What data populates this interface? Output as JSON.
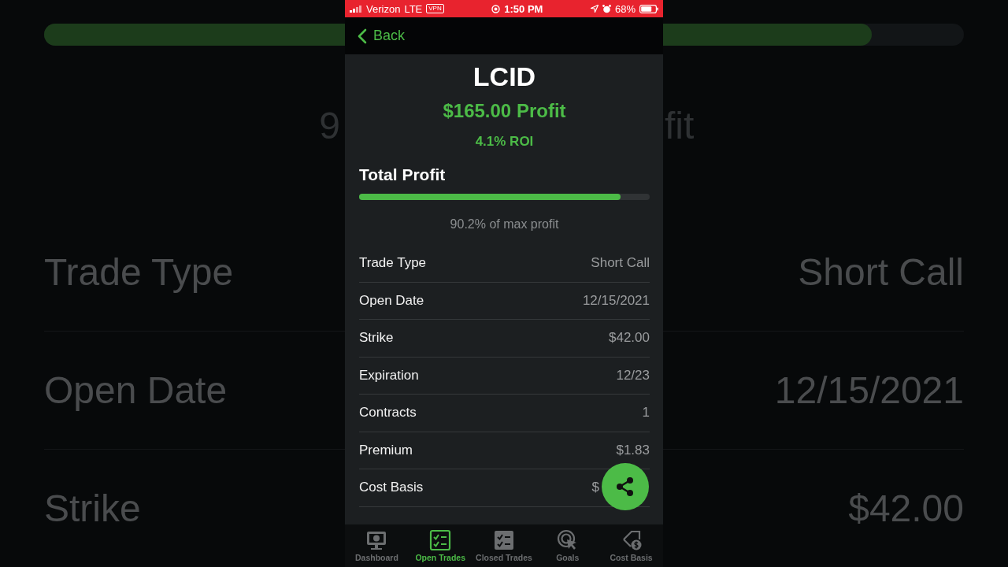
{
  "backdrop": {
    "progress": {
      "level": 0.9
    },
    "fragments": [
      "9",
      "fit"
    ],
    "rows": [
      {
        "label": "Trade Type",
        "value": "Short Call"
      },
      {
        "label": "Open Date",
        "value": "12/15/2021"
      },
      {
        "label": "Strike",
        "value": "$42.00"
      }
    ]
  },
  "status_bar": {
    "carrier": "Verizon",
    "network": "LTE",
    "vpn": "VPN",
    "time": "1:50 PM",
    "battery": "68%"
  },
  "nav": {
    "back": "Back"
  },
  "trade": {
    "symbol": "LCID",
    "profit": "$165.00 Profit",
    "roi": "4.1% ROI",
    "section_title": "Total Profit",
    "progress": {
      "level": 0.9
    },
    "progress_caption": "90.2% of max profit",
    "rows": [
      {
        "label": "Trade Type",
        "value": "Short Call"
      },
      {
        "label": "Open Date",
        "value": "12/15/2021"
      },
      {
        "label": "Strike",
        "value": "$42.00"
      },
      {
        "label": "Expiration",
        "value": "12/23"
      },
      {
        "label": "Contracts",
        "value": "1"
      },
      {
        "label": "Premium",
        "value": "$1.83"
      },
      {
        "label": "Cost Basis",
        "value": "$",
        "kind": "covered"
      }
    ]
  },
  "tab_bar": [
    {
      "label": "Dashboard",
      "selected": false
    },
    {
      "label": "Open Trades",
      "selected": true
    },
    {
      "label": "Closed Trades",
      "selected": false
    },
    {
      "label": "Goals",
      "selected": false
    },
    {
      "label": "Cost Basis",
      "selected": false
    }
  ]
}
